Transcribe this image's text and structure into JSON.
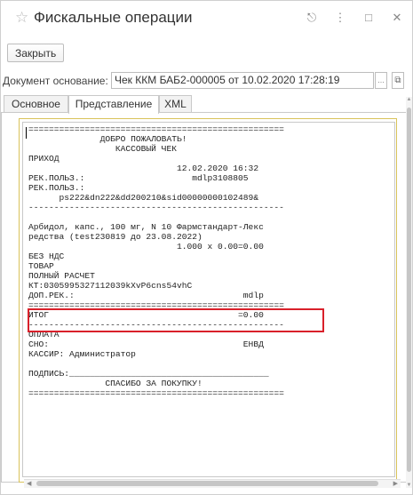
{
  "window": {
    "title": "Фискальные операции",
    "icons": [
      "link-icon",
      "more-icon",
      "maximize-icon",
      "close-icon"
    ],
    "icon_glyphs": [
      "⎋",
      "⋮",
      "□",
      "✕"
    ]
  },
  "toolbar": {
    "close_label": "Закрыть"
  },
  "document": {
    "label": "Документ основание:",
    "value": "Чек ККМ БАБ2-000005 от 10.02.2020 17:28:19",
    "dots": "...",
    "open_glyph": "⧉"
  },
  "tabs": [
    {
      "label": "Основное",
      "active": false
    },
    {
      "label": "Представление",
      "active": true
    },
    {
      "label": "XML",
      "active": false
    }
  ],
  "receipt": {
    "text": "==================================================\n              ДОБРО ПОЖАЛОВАТЬ!\n                 КАССОВЫЙ ЧЕК\nПРИХОД\n                             12.02.2020 16:32\nРЕК.ПОЛЬЗ.:                     mdlp3108805\nРЕК.ПОЛЬЗ.:\n      ps222&dn222&dd200210&sid00000000102489&\n--------------------------------------------------\n\nАрбидол, капс., 100 мг, N 10 Фармстандарт-Лекс\nредства (test230819 до 23.08.2022)\n                             1.000 x 0.00=0.00\nБЕЗ НДС\nТОВАР\nПОЛНЫЙ РАСЧЕТ\nКТ:0305995327112039kXvP6cns54vhC\nДОП.РЕК.:                                 mdlp\n==================================================\nИТОГ                                     =0.00\n--------------------------------------------------\nОПЛАТА\nСНО:                                      ЕНВД\nКАССИР: Администратор\n\nПОДПИСЬ:_______________________________________\n               СПАСИБО ЗА ПОКУПКУ!\n=================================================="
  }
}
